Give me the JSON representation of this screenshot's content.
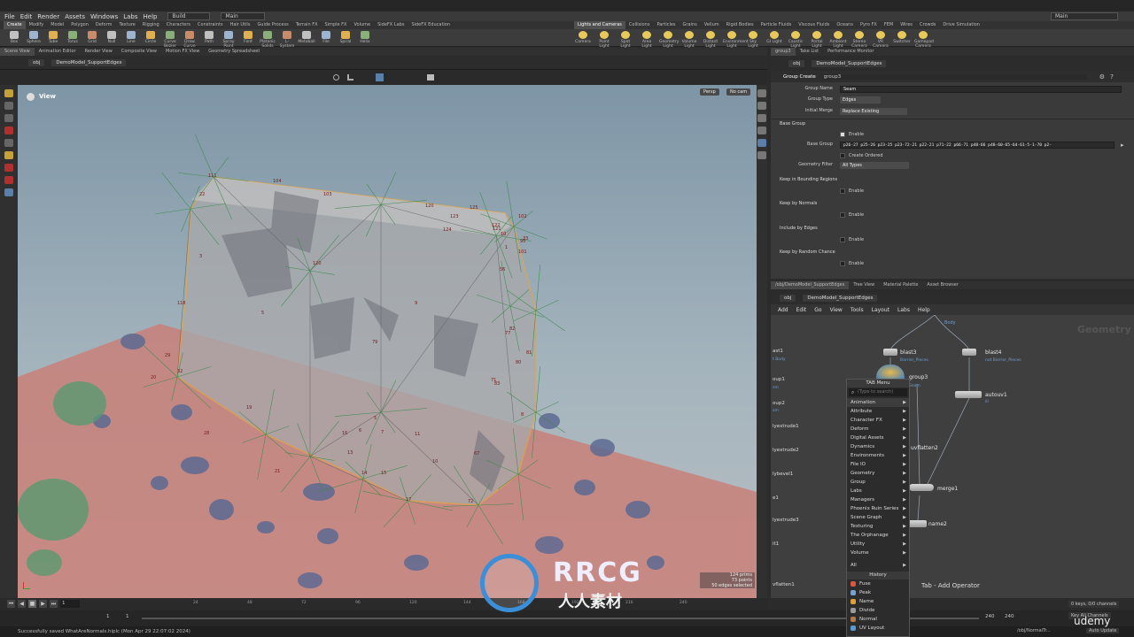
{
  "menubar": {
    "items": [
      "File",
      "Edit",
      "Render",
      "Assets",
      "Windows",
      "Labs",
      "Help"
    ],
    "desktop": "Build",
    "context": "Main",
    "right_context": "Main"
  },
  "shelf_tabs_left": [
    "Create",
    "Modify",
    "Model",
    "Polygon",
    "Deform",
    "Texture",
    "Rigging",
    "Characters",
    "Constraints",
    "Hair Utils",
    "Guide Process",
    "Terrain FX",
    "Simple FX",
    "Volume",
    "SideFX Labs",
    "SideFX Education"
  ],
  "shelf_tools_left": [
    "Box",
    "Sphere",
    "Tube",
    "Torus",
    "Grid",
    "Null",
    "Line",
    "Circle",
    "Curve Bezier",
    "Draw Curve",
    "Path",
    "Spray Paint",
    "Font",
    "Platonic Solids",
    "L-System",
    "Metaball",
    "File",
    "Spiral",
    "Helix"
  ],
  "shelf_tabs_right": [
    "Lights and Cameras",
    "Collisions",
    "Particles",
    "Grains",
    "Vellum",
    "Rigid Bodies",
    "Particle Fluids",
    "Viscous Fluids",
    "Oceans",
    "Pyro FX",
    "FEM",
    "Wires",
    "Crowds",
    "Drive Simulation"
  ],
  "shelf_tools_right": [
    "Camera",
    "Point Light",
    "Spot Light",
    "Area Light",
    "Geometry Light",
    "Volume Light",
    "Distant Light",
    "Environment Light",
    "Sky Light",
    "GI Light",
    "Caustic Light",
    "Portal Light",
    "Ambient Light",
    "Stereo Camera",
    "VR Camera",
    "Switcher",
    "Gamepad Camera"
  ],
  "left_pane_tabs": [
    "Scene View",
    "Animation Editor",
    "Render View",
    "Composite View",
    "Motion FX View",
    "Geometry Spreadsheet"
  ],
  "left_path": {
    "obj": "obj",
    "node": "DemoModel_SupportEdges"
  },
  "viewport": {
    "title": "View",
    "persp": "Persp",
    "cam": "No cam",
    "stats": [
      "124 prims",
      "73 points",
      "50 edges selected"
    ],
    "vertex_labels": [
      "111",
      "104",
      "103",
      "120",
      "123",
      "125",
      "124",
      "122",
      "121",
      "10",
      "102",
      "1",
      "101",
      "33",
      "56",
      "95",
      "22",
      "3",
      "120",
      "9",
      "5",
      "118",
      "79",
      "77",
      "82",
      "81",
      "80",
      "83",
      "8",
      "5",
      "6",
      "7",
      "16",
      "11",
      "10",
      "13",
      "14",
      "15",
      "17",
      "19",
      "67",
      "72",
      "71",
      "20",
      "21",
      "28",
      "29",
      "32"
    ]
  },
  "timeline": {
    "frame": "1",
    "ticks": [
      "24",
      "48",
      "72",
      "96",
      "120",
      "144",
      "168",
      "192",
      "216",
      "240"
    ]
  },
  "range": {
    "start": "1",
    "start2": "1",
    "end": "240",
    "end2": "240",
    "keys": "0 keys, 0/0 channels",
    "key_all": "Key All Channels",
    "auto": "Auto Update"
  },
  "status": {
    "message": "Successfully saved WhatAreNormals.hiplc (Mon Apr 29 22:07:02 2024)",
    "path": "/obj/NormalTr..."
  },
  "right_pane_tabs": [
    "group3",
    "Take List",
    "Performance Monitor"
  ],
  "right_path": {
    "obj": "obj",
    "node": "DemoModel_SupportEdges"
  },
  "params": {
    "op_type": "Group Create",
    "op_name": "group3",
    "group_name_label": "Group Name",
    "group_name": "Seam",
    "group_type_label": "Group Type",
    "group_type": "Edges",
    "initial_merge_label": "Initial Merge",
    "initial_merge": "Replace Existing",
    "base_group_section": "Base Group",
    "enable": "Enable",
    "base_group_label": "Base Group",
    "base_group": "p26-27 p25-26 p23-25 p23-72-21 p22-21 p71-22 p66-71 p48-66 p48-60-65-64-61-5-1-70 p2-",
    "create_ordered": "Create Ordered",
    "geometry_filter_label": "Geometry Filter",
    "geometry_filter": "All Types",
    "bounding_section": "Keep in Bounding Regions",
    "normals_section": "Keep by Normals",
    "edges_section": "Include by Edges",
    "random_section": "Keep by Random Chance"
  },
  "net_tabs": [
    "/obj/DemoModel_SupportEdges",
    "Tree View",
    "Material Palette",
    "Asset Browser"
  ],
  "net_path": {
    "obj": "obj",
    "node": "DemoModel_SupportEdges"
  },
  "net_menu": [
    "Add",
    "Edit",
    "Go",
    "View",
    "Tools",
    "Layout",
    "Labs",
    "Help"
  ],
  "network": {
    "watermark": "Geometry",
    "body_label": "Body",
    "nodes": [
      {
        "name": "blast3",
        "sub": "Barrier_Pieces"
      },
      {
        "name": "blast4",
        "sub": "not Barrier_Pieces"
      },
      {
        "name": "group3",
        "sub": "Seam"
      },
      {
        "name": "autouv1",
        "sub": "ill"
      },
      {
        "name": "uvflatten2",
        "sub": ""
      },
      {
        "name": "merge1",
        "sub": ""
      },
      {
        "name": "name2",
        "sub": ""
      }
    ],
    "left_labels": [
      "ast1",
      "t Body",
      "oup1",
      "sm",
      "oup2",
      "sm",
      "lyextrude1",
      "lyextrude2",
      "lybevel1",
      "e1",
      "lyextrude3",
      "it1",
      "vflatten1"
    ],
    "hint": "Tab - Add Operator"
  },
  "tab_menu": {
    "title": "TAB Menu",
    "search_placeholder": "(Type to search)",
    "items": [
      "Animation",
      "Attribute",
      "Character FX",
      "Deform",
      "Digital Assets",
      "Dynamics",
      "Environments",
      "File IO",
      "Geometry",
      "Group",
      "Labs",
      "Managers",
      "Phoenix Ruin Series",
      "Scene Graph",
      "Texturing",
      "The Orphanage",
      "Utility",
      "Volume"
    ],
    "all": "All",
    "history_title": "History",
    "history": [
      "Fuse",
      "Peak",
      "Name",
      "Divide",
      "Normal",
      "UV Layout"
    ]
  },
  "watermark": {
    "brand": "RRCG",
    "sub": "人人素材",
    "udemy": "udemy"
  },
  "colors": {
    "accent_orange": "#e8a33a",
    "node_blue": "#6d9fd0",
    "ground_red": "#c98079"
  }
}
